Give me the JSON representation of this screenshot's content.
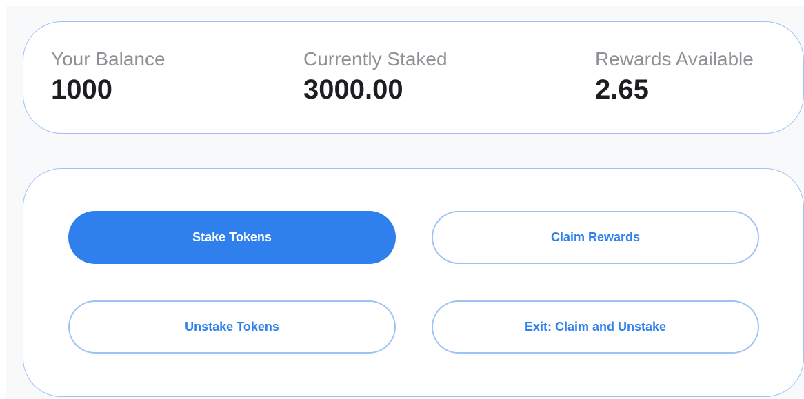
{
  "stats": {
    "balance": {
      "label": "Your Balance",
      "value": "1000"
    },
    "staked": {
      "label": "Currently Staked",
      "value": "3000.00"
    },
    "rewards": {
      "label": "Rewards Available",
      "value": "2.65"
    }
  },
  "actions": {
    "stake_label": "Stake Tokens",
    "claim_label": "Claim Rewards",
    "unstake_label": "Unstake Tokens",
    "exit_label": "Exit: Claim and Unstake"
  },
  "colors": {
    "accent": "#2f80ed",
    "border": "#9dc3f5",
    "label": "#8d9196",
    "value": "#1d1e21"
  }
}
